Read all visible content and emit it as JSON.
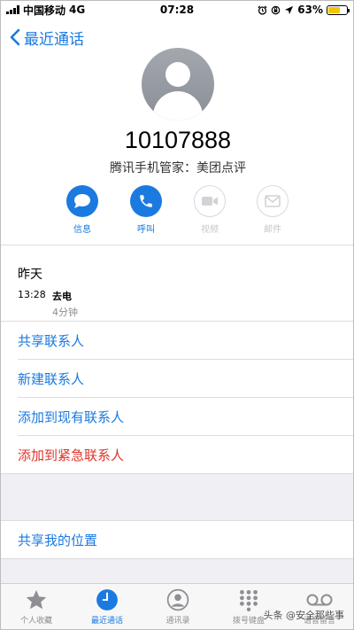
{
  "status_bar": {
    "carrier": "中国移动",
    "network": "4G",
    "time": "07:28",
    "battery_percent": "63%",
    "battery_level": 0.63
  },
  "nav": {
    "back_label": "最近通话"
  },
  "contact": {
    "number": "10107888",
    "caller_id": "腾讯手机管家：美团点评"
  },
  "actions": [
    {
      "label": "信息",
      "icon": "message-bubble-icon",
      "enabled": true
    },
    {
      "label": "呼叫",
      "icon": "phone-icon",
      "enabled": true
    },
    {
      "label": "视频",
      "icon": "video-camera-icon",
      "enabled": false
    },
    {
      "label": "邮件",
      "icon": "mail-icon",
      "enabled": false
    }
  ],
  "recents": {
    "day": "昨天",
    "entries": [
      {
        "time": "13:28",
        "type": "去电",
        "duration": "4分钟"
      }
    ]
  },
  "options": {
    "share_contact": "共享联系人",
    "new_contact": "新建联系人",
    "add_existing": "添加到现有联系人",
    "add_emergency": "添加到紧急联系人",
    "share_location": "共享我的位置"
  },
  "tabbar": {
    "active": "最近通话",
    "items": [
      {
        "label": "个人收藏",
        "icon": "star-icon"
      },
      {
        "label": "最近通话",
        "icon": "clock-icon"
      },
      {
        "label": "通讯录",
        "icon": "contacts-icon"
      },
      {
        "label": "拨号键盘",
        "icon": "keypad-icon"
      },
      {
        "label": "语音留言",
        "icon": "voicemail-icon"
      }
    ]
  },
  "watermark": {
    "text": "头条 @安全那些事"
  },
  "colors": {
    "accent": "#1a7ae0",
    "destructive": "#e0342a",
    "battery": "#f5c400"
  }
}
